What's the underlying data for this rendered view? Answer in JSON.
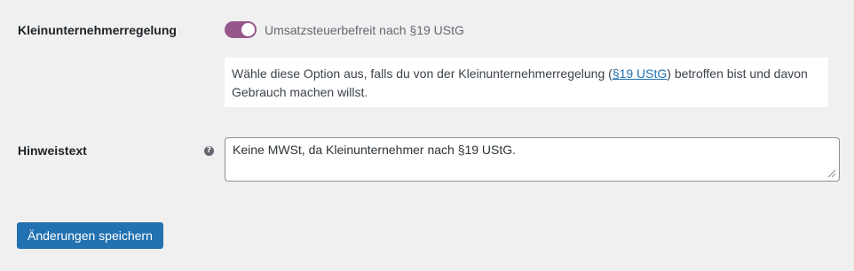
{
  "settings": {
    "kleinunternehmer": {
      "label": "Kleinunternehmerregelung",
      "toggle_on": true,
      "toggle_label": "Umsatzsteuerbefreit nach §19 UStG",
      "description_before": "Wähle diese Option aus, falls du von der Kleinunternehmerregelung (",
      "description_link": "§19 UStG",
      "description_after": ") betroffen bist und davon Gebrauch machen willst."
    },
    "hinweistext": {
      "label": "Hinweistext",
      "help_glyph": "?",
      "value": "Keine MWSt, da Kleinunternehmer nach §19 UStG."
    }
  },
  "actions": {
    "save_label": "Änderungen speichern"
  },
  "colors": {
    "toggle": "#96588a",
    "primary": "#2271b1",
    "background": "#f0f0f1"
  }
}
